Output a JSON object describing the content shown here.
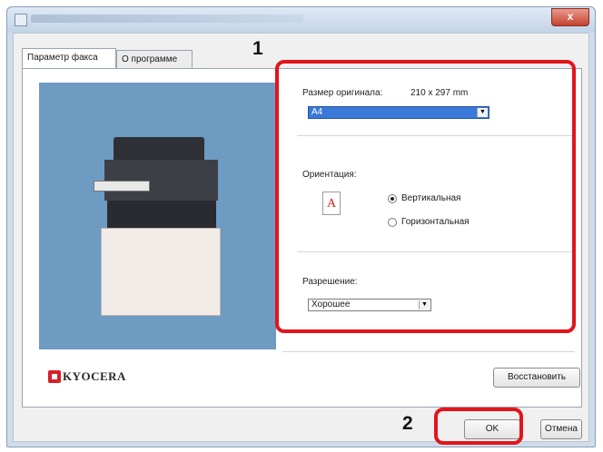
{
  "window": {
    "close_label": "x",
    "accent_color": "#e2151b"
  },
  "tabs": [
    {
      "label": "Параметр факса",
      "active": true
    },
    {
      "label": "О программе",
      "active": false
    }
  ],
  "brand": {
    "name": "KYOCERA"
  },
  "settings": {
    "original_size_label": "Размер оригинала:",
    "original_size_value": "210 x 297 mm",
    "paper_select": "A4",
    "orientation_label": "Ориентация:",
    "orientation_icon_glyph": "A",
    "orientation_options": [
      {
        "label": "Вертикальная",
        "checked": true
      },
      {
        "label": "Горизонтальная",
        "checked": false
      }
    ],
    "resolution_label": "Разрешение:",
    "resolution_select": "Хорошее"
  },
  "buttons": {
    "restore": "Восстановить",
    "ok": "OK",
    "cancel": "Отмена"
  },
  "callouts": {
    "one": "1",
    "two": "2"
  }
}
